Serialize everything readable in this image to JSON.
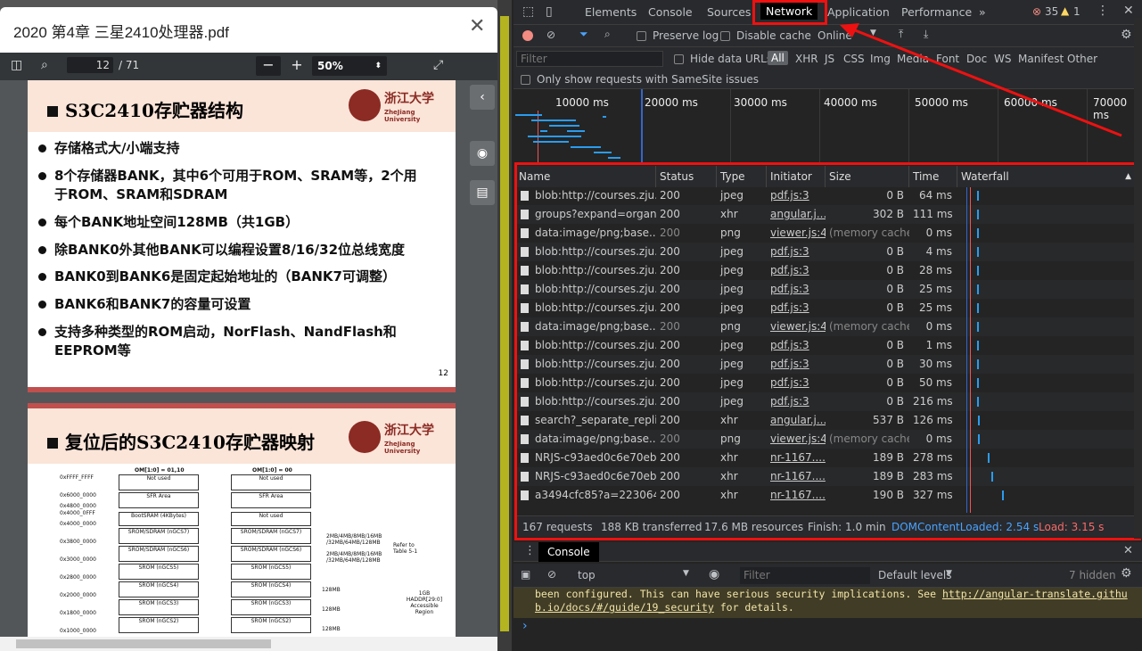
{
  "pdf": {
    "title": "2020 第4章 三星2410处理器.pdf",
    "page_current": "12",
    "page_total": "/ 71",
    "zoom": "50%",
    "slide1": {
      "title": "S3C2410存贮器结构",
      "logo_cn": "浙江大学",
      "logo_en": "ZheJiang University",
      "bullets": [
        "存储格式大/小端支持",
        "8个存储器BANK，其中6个可用于ROM、SRAM等，2个用于ROM、SRAM和SDRAM",
        "每个BANK地址空间128MB（共1GB）",
        "除BANK0外其他BANK可以编程设置8/16/32位总线宽度",
        "BANK0到BANK6是固定起始地址的（BANK7可调整）",
        "BANK6和BANK7的容量可设置",
        "支持多种类型的ROM启动，NorFlash、NandFlash和EEPROM等"
      ],
      "page_no": "12"
    },
    "slide2": {
      "title": "复位后的S3C2410存贮器映射",
      "logo_cn": "浙江大学",
      "logo_en": "ZheJiang University",
      "om_left": "OM[1:0] = 01,10",
      "om_right": "OM[1:0] = 00",
      "addresses": [
        "0xFFFF_FFFF",
        "0x6000_0000",
        "0x4800_0000",
        "0x4000_0FFF",
        "0x4000_0000",
        "0x3800_0000",
        "0x3000_0000",
        "0x2800_0000",
        "0x2000_0000",
        "0x1800_0000",
        "0x1000_0000"
      ],
      "left_boxes": [
        "Not used",
        "SFR Area",
        "BootSRAM (4KBytes)",
        "SROM/SDRAM (nGCS7)",
        "SROM/SDRAM (nGCS6)",
        "SROM (nGCS5)",
        "SROM (nGCS4)",
        "SROM (nGCS3)",
        "SROM (nGCS2)"
      ],
      "right_boxes": [
        "Not used",
        "SFR Area",
        "Not used",
        "SROM/SDRAM (nGCS7)",
        "SROM/SDRAM (nGCS6)",
        "SROM (nGCS5)",
        "SROM (nGCS4)",
        "SROM (nGCS3)",
        "SROM (nGCS2)"
      ],
      "sizes": [
        "2MB/4MB/8MB/16MB /32MB/64MB/128MB",
        "2MB/4MB/8MB/16MB /32MB/64MB/128MB",
        "128MB",
        "128MB",
        "128MB",
        "128MB"
      ],
      "refer": "Refer to Table 5-1",
      "region": "1GB HADDR[29:0] Accessible Region"
    }
  },
  "devtools": {
    "tabs": [
      "Elements",
      "Console",
      "Sources",
      "Network",
      "Application",
      "Performance"
    ],
    "more_tabs": "»",
    "errors": "35",
    "warnings": "1",
    "preserve_log": "Preserve log",
    "disable_cache": "Disable cache",
    "throttle": "Online",
    "filter_placeholder": "Filter",
    "hide_data_urls": "Hide data URLs",
    "type_filters": [
      "All",
      "XHR",
      "JS",
      "CSS",
      "Img",
      "Media",
      "Font",
      "Doc",
      "WS",
      "Manifest",
      "Other"
    ],
    "samesite": "Only show requests with SameSite issues",
    "timeline_labels": [
      "10000 ms",
      "20000 ms",
      "30000 ms",
      "40000 ms",
      "50000 ms",
      "60000 ms",
      "70000 ms"
    ],
    "columns": [
      "Name",
      "Status",
      "Type",
      "Initiator",
      "Size",
      "Time",
      "Waterfall"
    ],
    "rows": [
      {
        "name": "blob:http://courses.zju....",
        "status": "200",
        "type": "jpeg",
        "initiator": "pdf.js:3",
        "size": "0 B",
        "time": "64 ms"
      },
      {
        "name": "groups?expand=organ...",
        "status": "200",
        "type": "xhr",
        "initiator": "angular.j...",
        "size": "302 B",
        "time": "111 ms"
      },
      {
        "name": "data:image/png;base...",
        "status": "200",
        "type": "png",
        "initiator": "viewer.js:4",
        "size": "(memory cache)",
        "time": "0 ms"
      },
      {
        "name": "blob:http://courses.zju....",
        "status": "200",
        "type": "jpeg",
        "initiator": "pdf.js:3",
        "size": "0 B",
        "time": "4 ms"
      },
      {
        "name": "blob:http://courses.zju....",
        "status": "200",
        "type": "jpeg",
        "initiator": "pdf.js:3",
        "size": "0 B",
        "time": "28 ms"
      },
      {
        "name": "blob:http://courses.zju....",
        "status": "200",
        "type": "jpeg",
        "initiator": "pdf.js:3",
        "size": "0 B",
        "time": "25 ms"
      },
      {
        "name": "blob:http://courses.zju....",
        "status": "200",
        "type": "jpeg",
        "initiator": "pdf.js:3",
        "size": "0 B",
        "time": "25 ms"
      },
      {
        "name": "data:image/png;base...",
        "status": "200",
        "type": "png",
        "initiator": "viewer.js:4",
        "size": "(memory cache)",
        "time": "0 ms"
      },
      {
        "name": "blob:http://courses.zju....",
        "status": "200",
        "type": "jpeg",
        "initiator": "pdf.js:3",
        "size": "0 B",
        "time": "1 ms"
      },
      {
        "name": "blob:http://courses.zju....",
        "status": "200",
        "type": "jpeg",
        "initiator": "pdf.js:3",
        "size": "0 B",
        "time": "30 ms"
      },
      {
        "name": "blob:http://courses.zju....",
        "status": "200",
        "type": "jpeg",
        "initiator": "pdf.js:3",
        "size": "0 B",
        "time": "50 ms"
      },
      {
        "name": "blob:http://courses.zju....",
        "status": "200",
        "type": "jpeg",
        "initiator": "pdf.js:3",
        "size": "0 B",
        "time": "216 ms"
      },
      {
        "name": "search?_separate_repli...",
        "status": "200",
        "type": "xhr",
        "initiator": "angular.j...",
        "size": "537 B",
        "time": "126 ms"
      },
      {
        "name": "data:image/png;base...",
        "status": "200",
        "type": "png",
        "initiator": "viewer.js:4",
        "size": "(memory cache)",
        "time": "0 ms"
      },
      {
        "name": "NRJS-c93aed0c6e70eb...",
        "status": "200",
        "type": "xhr",
        "initiator": "nr-1167....",
        "size": "189 B",
        "time": "278 ms"
      },
      {
        "name": "NRJS-c93aed0c6e70eb...",
        "status": "200",
        "type": "xhr",
        "initiator": "nr-1167....",
        "size": "189 B",
        "time": "283 ms"
      },
      {
        "name": "a3494cfc85?a=223064...",
        "status": "200",
        "type": "xhr",
        "initiator": "nr-1167....",
        "size": "190 B",
        "time": "327 ms"
      }
    ],
    "status": {
      "requests": "167 requests",
      "transferred": "188 KB transferred",
      "resources": "17.6 MB resources",
      "finish": "Finish: 1.0 min",
      "dcl": "DOMContentLoaded: 2.54 s",
      "load": "Load: 3.15 s"
    },
    "console": {
      "tab": "Console",
      "context": "top",
      "filter_placeholder": "Filter",
      "levels": "Default levels",
      "hidden": "7 hidden",
      "warn_line1": "been configured. This can have serious security implications. See ",
      "warn_link1": "http://angular-translate.githu",
      "warn_link2": "b.io/docs/#/guide/19_security",
      "warn_tail": " for details.",
      "prompt": "›"
    },
    "colors": {
      "accent": "#1a73e8",
      "dcl": "#4aa3ff",
      "load": "#f76b6b",
      "highlight": "#e11111"
    }
  }
}
